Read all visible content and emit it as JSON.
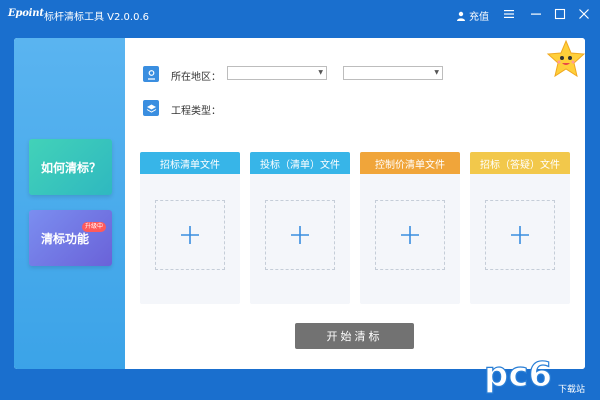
{
  "titlebar": {
    "logo": "Epoint",
    "title": "标杆清标工具 V2.0.0.6",
    "user_label": "充值"
  },
  "sidebar": {
    "items": [
      {
        "label": "如何清标？"
      },
      {
        "label": "清标功能",
        "badge": "升级中"
      }
    ]
  },
  "form": {
    "region_label": "所在地区：",
    "project_type_label": "工程类型：",
    "region_select_1": "",
    "region_select_2": ""
  },
  "cards": [
    {
      "title": "招标清单文件",
      "color": "#37b5e8"
    },
    {
      "title": "投标（清单）文件",
      "color": "#37b5e8"
    },
    {
      "title": "控制价清单文件",
      "color": "#f0a53a"
    },
    {
      "title": "招标（答疑）文件",
      "color": "#f2c84b"
    }
  ],
  "actions": {
    "start_label": "开始清标"
  },
  "watermark": {
    "text": "pc6",
    "sub": "下载站"
  },
  "colors": {
    "titlebar": "#1a6fce",
    "sidebar": "#4aaced",
    "accent_blue": "#3a8ee0",
    "start_button": "#727272"
  }
}
